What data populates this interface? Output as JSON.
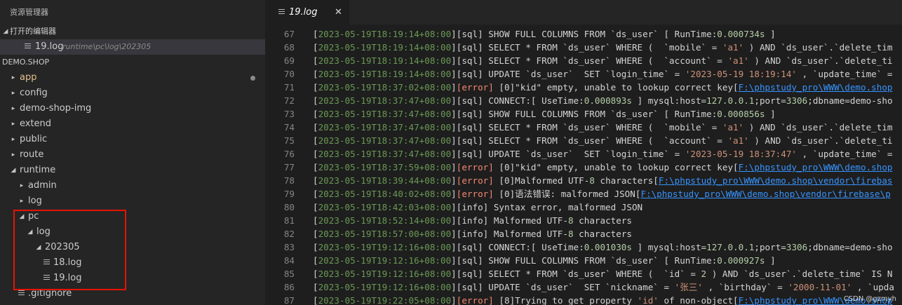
{
  "explorer": {
    "title": "资源管理器",
    "open_editors_label": "打开的编辑器",
    "open_file_name": "19.log",
    "open_file_path": "runtime\\pc\\log\\202305",
    "workspace_label": "DEMO.SHOP",
    "tree": [
      {
        "label": "app",
        "twisty": "▸",
        "modified": true
      },
      {
        "label": "config",
        "twisty": "▸"
      },
      {
        "label": "demo-shop-img",
        "twisty": "▸"
      },
      {
        "label": "extend",
        "twisty": "▸"
      },
      {
        "label": "public",
        "twisty": "▸"
      },
      {
        "label": "route",
        "twisty": "▸"
      },
      {
        "label": "runtime",
        "twisty": "◢"
      },
      {
        "label": "admin",
        "twisty": "▸"
      },
      {
        "label": "log",
        "twisty": "▸"
      },
      {
        "label": "pc",
        "twisty": "◢"
      },
      {
        "label": "log",
        "twisty": "◢"
      },
      {
        "label": "202305",
        "twisty": "◢"
      },
      {
        "label": "18.log",
        "file": true
      },
      {
        "label": "19.log",
        "file": true
      },
      {
        "label": ".gitignore",
        "file": true
      }
    ]
  },
  "tab": {
    "label": "19.log",
    "close": "✕"
  },
  "editor": {
    "lines": [
      {
        "n": "67",
        "parts": [
          {
            "c": "br",
            "t": "["
          },
          {
            "c": "ts",
            "t": "2023-05-19T18:19:14+08:00"
          },
          {
            "c": "br",
            "t": "]"
          },
          {
            "c": "lev-sql",
            "t": "[sql] SHOW FULL COLUMNS FROM `ds_user` [ RunTime:"
          },
          {
            "c": "num",
            "t": "0.000734s"
          },
          {
            "c": "br",
            "t": " ]"
          }
        ]
      },
      {
        "n": "68",
        "parts": [
          {
            "c": "br",
            "t": "["
          },
          {
            "c": "ts",
            "t": "2023-05-19T18:19:14+08:00"
          },
          {
            "c": "br",
            "t": "]"
          },
          {
            "c": "lev-sql",
            "t": "[sql] SELECT * FROM `ds_user` WHERE (  `mobile` = "
          },
          {
            "c": "str",
            "t": "'a1'"
          },
          {
            "c": "br",
            "t": " ) AND `ds_user`.`delete_tim"
          }
        ]
      },
      {
        "n": "69",
        "parts": [
          {
            "c": "br",
            "t": "["
          },
          {
            "c": "ts",
            "t": "2023-05-19T18:19:14+08:00"
          },
          {
            "c": "br",
            "t": "]"
          },
          {
            "c": "lev-sql",
            "t": "[sql] SELECT * FROM `ds_user` WHERE (  `account` = "
          },
          {
            "c": "str",
            "t": "'a1'"
          },
          {
            "c": "br",
            "t": " ) AND `ds_user`.`delete_ti"
          }
        ]
      },
      {
        "n": "70",
        "parts": [
          {
            "c": "br",
            "t": "["
          },
          {
            "c": "ts",
            "t": "2023-05-19T18:19:14+08:00"
          },
          {
            "c": "br",
            "t": "]"
          },
          {
            "c": "lev-sql",
            "t": "[sql] UPDATE `ds_user`  SET `login_time` = "
          },
          {
            "c": "str",
            "t": "'2023-05-19 18:19:14'"
          },
          {
            "c": "br",
            "t": " , `update_time` ="
          }
        ]
      },
      {
        "n": "71",
        "parts": [
          {
            "c": "br",
            "t": "["
          },
          {
            "c": "ts",
            "t": "2023-05-19T18:37:02+08:00"
          },
          {
            "c": "br",
            "t": "]"
          },
          {
            "c": "lev-error",
            "t": "[error]"
          },
          {
            "c": "br",
            "t": " [0]\"kid\" empty, unable to lookup correct key["
          },
          {
            "c": "path",
            "t": "F:\\phpstudy_pro\\WWW\\demo.shop"
          }
        ]
      },
      {
        "n": "72",
        "parts": [
          {
            "c": "br",
            "t": "["
          },
          {
            "c": "ts",
            "t": "2023-05-19T18:37:47+08:00"
          },
          {
            "c": "br",
            "t": "]"
          },
          {
            "c": "lev-sql",
            "t": "[sql] CONNECT:[ UseTime:"
          },
          {
            "c": "num",
            "t": "0.000893s"
          },
          {
            "c": "br",
            "t": " ] mysql:host="
          },
          {
            "c": "num",
            "t": "127.0.0.1"
          },
          {
            "c": "br",
            "t": ";port="
          },
          {
            "c": "num",
            "t": "3306"
          },
          {
            "c": "br",
            "t": ";dbname=demo-sho"
          }
        ]
      },
      {
        "n": "73",
        "parts": [
          {
            "c": "br",
            "t": "["
          },
          {
            "c": "ts",
            "t": "2023-05-19T18:37:47+08:00"
          },
          {
            "c": "br",
            "t": "]"
          },
          {
            "c": "lev-sql",
            "t": "[sql] SHOW FULL COLUMNS FROM `ds_user` [ RunTime:"
          },
          {
            "c": "num",
            "t": "0.000856s"
          },
          {
            "c": "br",
            "t": " ]"
          }
        ]
      },
      {
        "n": "74",
        "parts": [
          {
            "c": "br",
            "t": "["
          },
          {
            "c": "ts",
            "t": "2023-05-19T18:37:47+08:00"
          },
          {
            "c": "br",
            "t": "]"
          },
          {
            "c": "lev-sql",
            "t": "[sql] SELECT * FROM `ds_user` WHERE (  `mobile` = "
          },
          {
            "c": "str",
            "t": "'a1'"
          },
          {
            "c": "br",
            "t": " ) AND `ds_user`.`delete_tim"
          }
        ]
      },
      {
        "n": "75",
        "parts": [
          {
            "c": "br",
            "t": "["
          },
          {
            "c": "ts",
            "t": "2023-05-19T18:37:47+08:00"
          },
          {
            "c": "br",
            "t": "]"
          },
          {
            "c": "lev-sql",
            "t": "[sql] SELECT * FROM `ds_user` WHERE (  `account` = "
          },
          {
            "c": "str",
            "t": "'a1'"
          },
          {
            "c": "br",
            "t": " ) AND `ds_user`.`delete_ti"
          }
        ]
      },
      {
        "n": "76",
        "parts": [
          {
            "c": "br",
            "t": "["
          },
          {
            "c": "ts",
            "t": "2023-05-19T18:37:47+08:00"
          },
          {
            "c": "br",
            "t": "]"
          },
          {
            "c": "lev-sql",
            "t": "[sql] UPDATE `ds_user`  SET `login_time` = "
          },
          {
            "c": "str",
            "t": "'2023-05-19 18:37:47'"
          },
          {
            "c": "br",
            "t": " , `update_time` ="
          }
        ]
      },
      {
        "n": "77",
        "parts": [
          {
            "c": "br",
            "t": "["
          },
          {
            "c": "ts",
            "t": "2023-05-19T18:37:59+08:00"
          },
          {
            "c": "br",
            "t": "]"
          },
          {
            "c": "lev-error",
            "t": "[error]"
          },
          {
            "c": "br",
            "t": " [0]\"kid\" empty, unable to lookup correct key["
          },
          {
            "c": "path",
            "t": "F:\\phpstudy_pro\\WWW\\demo.shop"
          }
        ]
      },
      {
        "n": "78",
        "parts": [
          {
            "c": "br",
            "t": "["
          },
          {
            "c": "ts",
            "t": "2023-05-19T18:39:44+08:00"
          },
          {
            "c": "br",
            "t": "]"
          },
          {
            "c": "lev-error",
            "t": "[error]"
          },
          {
            "c": "br",
            "t": " [0]Malformed UTF-"
          },
          {
            "c": "num",
            "t": "8"
          },
          {
            "c": "br",
            "t": " characters["
          },
          {
            "c": "path",
            "t": "F:\\phpstudy_pro\\WWW\\demo.shop\\vendor\\firebas"
          }
        ]
      },
      {
        "n": "79",
        "parts": [
          {
            "c": "br",
            "t": "["
          },
          {
            "c": "ts",
            "t": "2023-05-19T18:40:02+08:00"
          },
          {
            "c": "br",
            "t": "]"
          },
          {
            "c": "lev-error",
            "t": "[error]"
          },
          {
            "c": "br",
            "t": " [0]语法错误: malformed JSON["
          },
          {
            "c": "path",
            "t": "F:\\phpstudy_pro\\WWW\\demo.shop\\vendor\\firebase\\p"
          }
        ]
      },
      {
        "n": "80",
        "parts": [
          {
            "c": "br",
            "t": "["
          },
          {
            "c": "ts",
            "t": "2023-05-19T18:42:03+08:00"
          },
          {
            "c": "br",
            "t": "]"
          },
          {
            "c": "lev-info",
            "t": "[info] Syntax error, malformed JSON"
          }
        ]
      },
      {
        "n": "81",
        "parts": [
          {
            "c": "br",
            "t": "["
          },
          {
            "c": "ts",
            "t": "2023-05-19T18:52:14+08:00"
          },
          {
            "c": "br",
            "t": "]"
          },
          {
            "c": "lev-info",
            "t": "[info] Malformed UTF-"
          },
          {
            "c": "num",
            "t": "8"
          },
          {
            "c": "br",
            "t": " characters"
          }
        ]
      },
      {
        "n": "82",
        "parts": [
          {
            "c": "br",
            "t": "["
          },
          {
            "c": "ts",
            "t": "2023-05-19T18:57:00+08:00"
          },
          {
            "c": "br",
            "t": "]"
          },
          {
            "c": "lev-info",
            "t": "[info] Malformed UTF-"
          },
          {
            "c": "num",
            "t": "8"
          },
          {
            "c": "br",
            "t": " characters"
          }
        ]
      },
      {
        "n": "83",
        "parts": [
          {
            "c": "br",
            "t": "["
          },
          {
            "c": "ts",
            "t": "2023-05-19T19:12:16+08:00"
          },
          {
            "c": "br",
            "t": "]"
          },
          {
            "c": "lev-sql",
            "t": "[sql] CONNECT:[ UseTime:"
          },
          {
            "c": "num",
            "t": "0.001030s"
          },
          {
            "c": "br",
            "t": " ] mysql:host="
          },
          {
            "c": "num",
            "t": "127.0.0.1"
          },
          {
            "c": "br",
            "t": ";port="
          },
          {
            "c": "num",
            "t": "3306"
          },
          {
            "c": "br",
            "t": ";dbname=demo-sho"
          }
        ]
      },
      {
        "n": "84",
        "parts": [
          {
            "c": "br",
            "t": "["
          },
          {
            "c": "ts",
            "t": "2023-05-19T19:12:16+08:00"
          },
          {
            "c": "br",
            "t": "]"
          },
          {
            "c": "lev-sql",
            "t": "[sql] SHOW FULL COLUMNS FROM `ds_user` [ RunTime:"
          },
          {
            "c": "num",
            "t": "0.000927s"
          },
          {
            "c": "br",
            "t": " ]"
          }
        ]
      },
      {
        "n": "85",
        "parts": [
          {
            "c": "br",
            "t": "["
          },
          {
            "c": "ts",
            "t": "2023-05-19T19:12:16+08:00"
          },
          {
            "c": "br",
            "t": "]"
          },
          {
            "c": "lev-sql",
            "t": "[sql] SELECT * FROM `ds_user` WHERE (  `id` = "
          },
          {
            "c": "num",
            "t": "2"
          },
          {
            "c": "br",
            "t": " ) AND `ds_user`.`delete_time` IS N"
          }
        ]
      },
      {
        "n": "86",
        "parts": [
          {
            "c": "br",
            "t": "["
          },
          {
            "c": "ts",
            "t": "2023-05-19T19:12:16+08:00"
          },
          {
            "c": "br",
            "t": "]"
          },
          {
            "c": "lev-sql",
            "t": "[sql] UPDATE `ds_user`  SET `nickname` = "
          },
          {
            "c": "str",
            "t": "'张三'"
          },
          {
            "c": "br",
            "t": " , `birthday` = "
          },
          {
            "c": "str",
            "t": "'2000-11-01'"
          },
          {
            "c": "br",
            "t": " , `upda"
          }
        ]
      },
      {
        "n": "87",
        "parts": [
          {
            "c": "br",
            "t": "["
          },
          {
            "c": "ts",
            "t": "2023-05-19T19:22:05+08:00"
          },
          {
            "c": "br",
            "t": "]"
          },
          {
            "c": "lev-error",
            "t": "[error]"
          },
          {
            "c": "br",
            "t": " [8]Trying to get property "
          },
          {
            "c": "str",
            "t": "'id'"
          },
          {
            "c": "br",
            "t": " of non-object["
          },
          {
            "c": "path",
            "t": "F:\\phpstudy_pro\\WWW\\demo.shop"
          }
        ]
      }
    ]
  },
  "watermark": "CSDN @gzmyh"
}
